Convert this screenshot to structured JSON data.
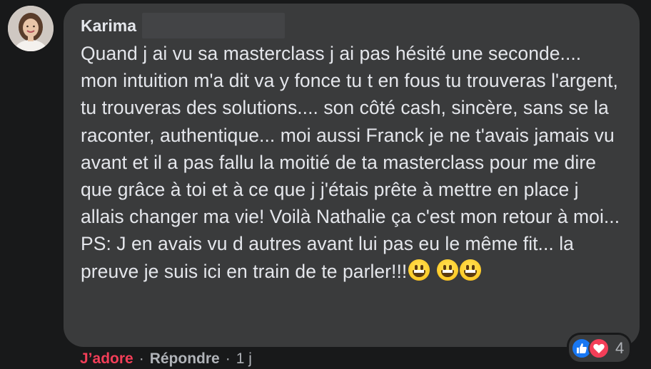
{
  "comment": {
    "author": "Karima",
    "text": "Quand j ai vu sa masterclass j ai pas hésité une seconde.... mon intuition m'a dit va y fonce tu t en fous tu trouveras l'argent, tu trouveras des solutions.... son côté cash, sincère, sans se la raconter, authentique... moi aussi Franck je ne t'avais jamais vu avant et il a pas fallu la moitié de ta masterclass pour me dire que grâce à toi et à ce que j j'étais prête à mettre en place j allais changer ma vie! Voilà Nathalie ça c'est mon retour à moi... PS: J en avais vu d autres avant lui pas eu le même fit... la preuve je suis ici en train de te parler!!!",
    "emojis": [
      "grinning-face-emoji",
      "grinning-face-emoji",
      "grinning-face-emoji"
    ]
  },
  "reactions": {
    "icons": [
      "like-icon",
      "love-icon"
    ],
    "count": "4"
  },
  "actions": {
    "love_label": "J’adore",
    "reply_label": "Répondre",
    "separator": "·",
    "time": "1 j"
  },
  "colors": {
    "background": "#18191a",
    "bubble": "#3a3b3c",
    "text": "#e4e6eb",
    "muted": "#b0b3b8",
    "love": "#f33e58",
    "like": "#1877f2"
  }
}
